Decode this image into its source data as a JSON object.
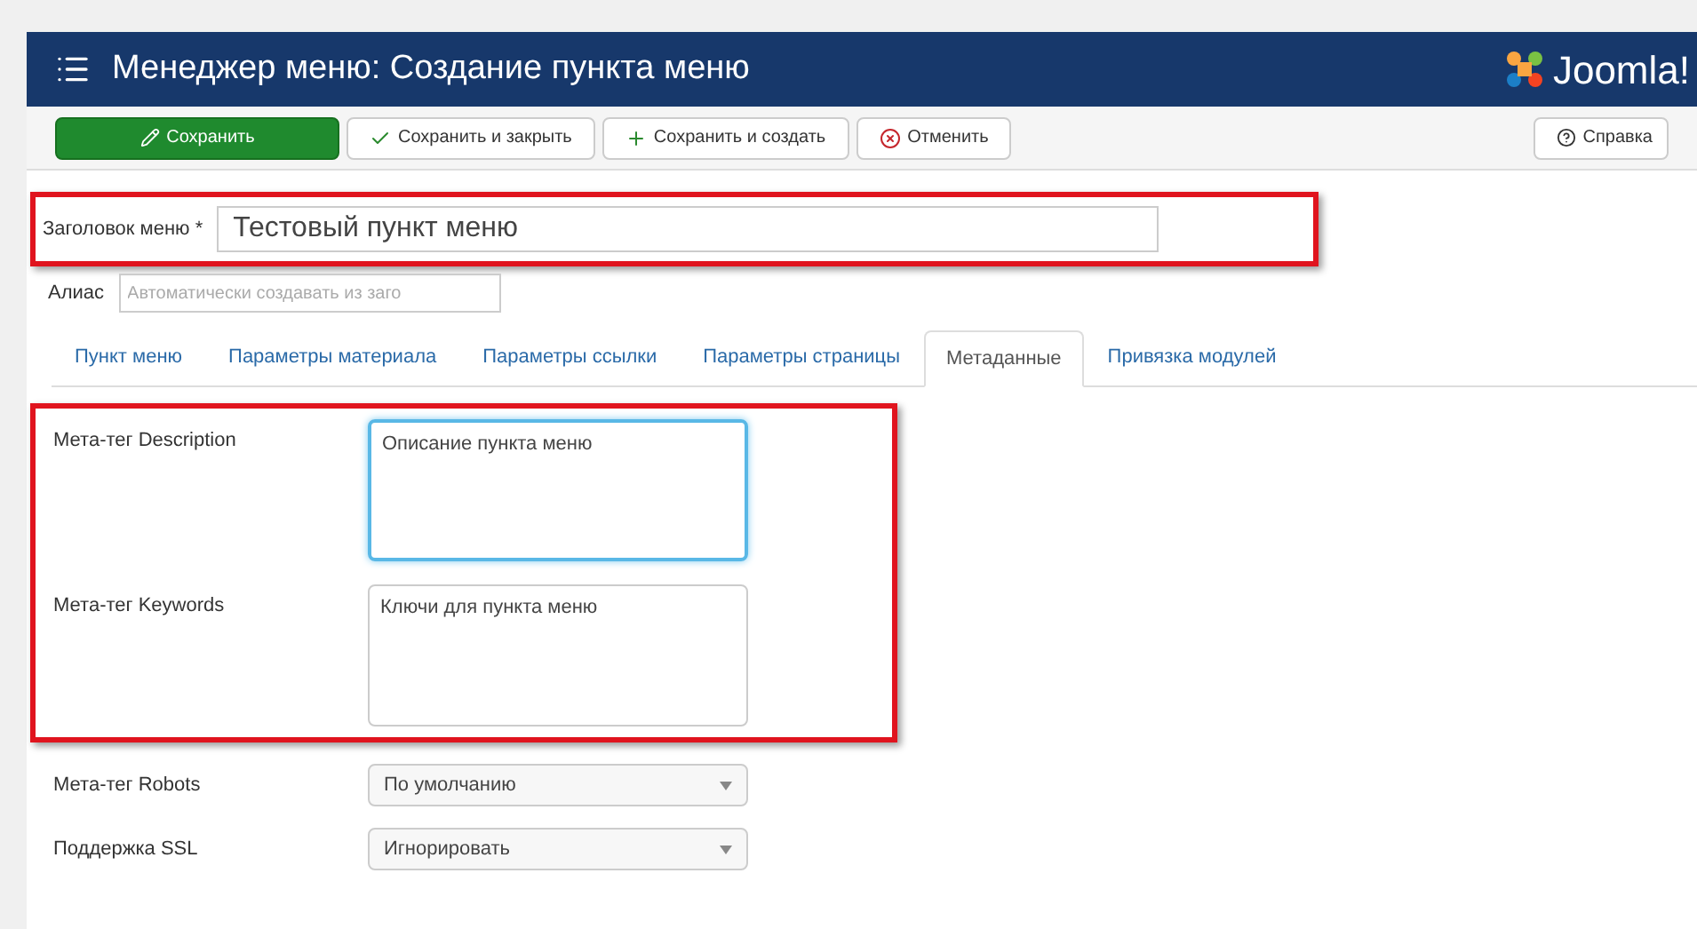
{
  "header": {
    "title": "Менеджер меню: Создание пункта меню",
    "logo": "Joomla!"
  },
  "toolbar": [
    {
      "kind": "save",
      "label": "Сохранить"
    },
    {
      "kind": "close",
      "label": "Сохранить и закрыть"
    },
    {
      "kind": "new",
      "label": "Сохранить и создать"
    },
    {
      "kind": "cancel",
      "label": "Отменить"
    }
  ],
  "help_button": {
    "label": "Справка"
  },
  "title_field": {
    "label": "Заголовок меню *",
    "value": "Тестовый пункт меню",
    "highlighted": true
  },
  "alias_field": {
    "label": "Алиас",
    "placeholder": "Автоматически создавать из заго"
  },
  "tabs": [
    {
      "label": "Пункт меню",
      "selected": false
    },
    {
      "label": "Параметры материала",
      "selected": false
    },
    {
      "label": "Параметры ссылки",
      "selected": false
    },
    {
      "label": "Параметры страницы",
      "selected": false
    },
    {
      "label": "Метаданные",
      "selected": true
    },
    {
      "label": "Привязка модулей",
      "selected": false
    }
  ],
  "meta_group": {
    "highlighted": true,
    "fields": [
      {
        "label": "Мета-тег Description",
        "value": "Описание пункта меню",
        "focused": true
      },
      {
        "label": "Мета-тег Keywords",
        "value": "Ключи для пункта меню",
        "focused": false
      }
    ]
  },
  "selects": [
    {
      "label": "Мета-тег Robots",
      "value": "По умолчанию"
    },
    {
      "label": "Поддержка SSL",
      "value": "Игнорировать"
    }
  ]
}
